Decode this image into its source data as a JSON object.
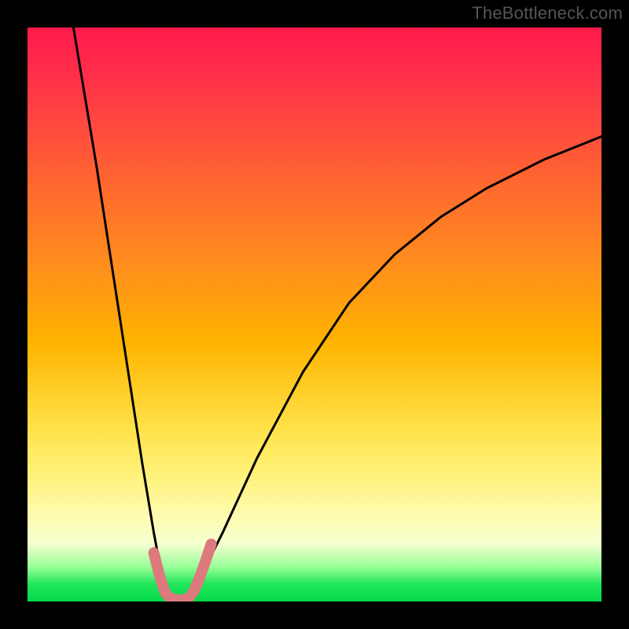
{
  "watermark": "TheBottleneck.com",
  "chart_data": {
    "type": "line",
    "title": "",
    "xlabel": "",
    "ylabel": "",
    "xlim": [
      0,
      100
    ],
    "ylim": [
      0,
      100
    ],
    "series": [
      {
        "name": "bottleneck-curve-black",
        "stroke": "#000000",
        "stroke_width": 3,
        "x": [
          8,
          10,
          12,
          14,
          16,
          18,
          20,
          22,
          23.5,
          25,
          27,
          30,
          34,
          40,
          48,
          56,
          64,
          72,
          80,
          90,
          100
        ],
        "y": [
          100,
          88,
          76,
          63,
          50,
          37,
          24,
          12,
          4,
          0,
          0,
          4,
          12,
          25,
          40,
          52,
          60.5,
          67,
          72,
          77,
          81
        ]
      },
      {
        "name": "ideal-zone-marker-pink",
        "stroke": "#dd7a7d",
        "stroke_width": 14,
        "x": [
          22,
          23,
          24,
          25,
          26,
          27,
          28,
          29,
          30,
          31,
          32
        ],
        "y": [
          8.5,
          4.5,
          1.5,
          0.5,
          0.3,
          0.3,
          0.5,
          1.8,
          4.2,
          7,
          10
        ]
      }
    ],
    "gradient_bands": [
      {
        "at_pct": 0,
        "color": "#ff1a4b"
      },
      {
        "at_pct": 55,
        "color": "#ffb400"
      },
      {
        "at_pct": 78,
        "color": "#fff27a"
      },
      {
        "at_pct": 97,
        "color": "#20e65a"
      },
      {
        "at_pct": 100,
        "color": "#05d84a"
      }
    ]
  }
}
